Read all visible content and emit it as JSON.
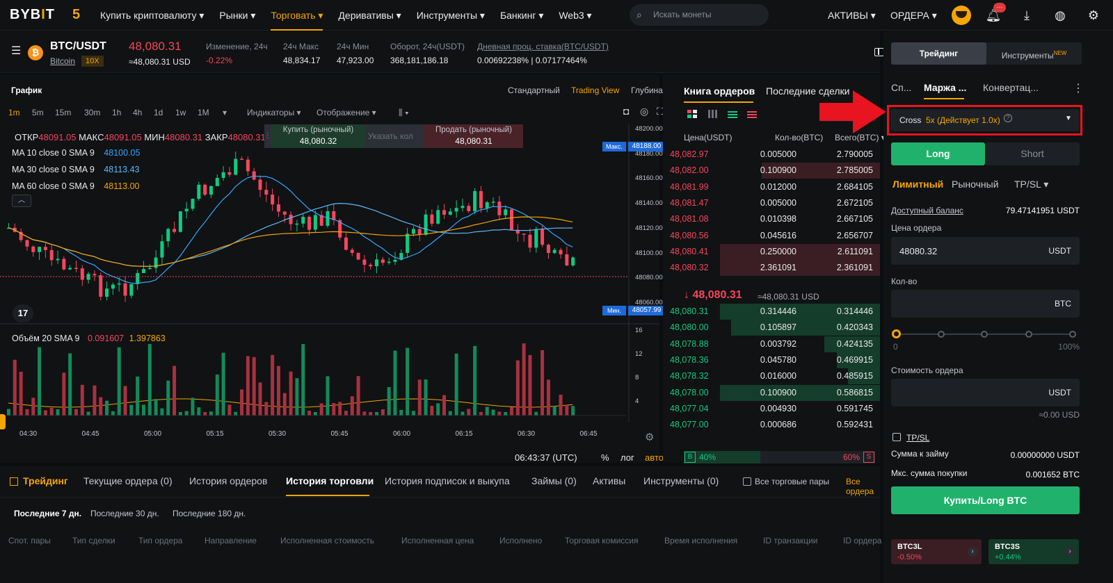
{
  "topnav": {
    "logo_a": "BYB",
    "logo_i": "I",
    "logo_b": "T",
    "logo_anniv": "5",
    "items": [
      {
        "label": "Купить криптовалюту ▾"
      },
      {
        "label": "Рынки ▾"
      },
      {
        "label": "Торговать ▾"
      },
      {
        "label": "Деривативы ▾"
      },
      {
        "label": "Инструменты ▾"
      },
      {
        "label": "Банкинг ▾"
      },
      {
        "label": "Web3 ▾"
      }
    ],
    "search_placeholder": "Искать монеты",
    "assets": "АКТИВЫ ▾",
    "orders": "ОРДЕРА ▾",
    "notif_badge": "···"
  },
  "ticker": {
    "pair": "BTC/USDT",
    "coin": "Bitcoin",
    "leverage": "10X",
    "price": "48,080.31",
    "price_usd": "≈48,080.31 USD",
    "change_label": "Изменение, 24ч",
    "change_value": "-0.22%",
    "high_label": "24ч Макс",
    "high_value": "48,834.17",
    "low_label": "24ч Мин",
    "low_value": "47,923.00",
    "turnover_label": "Оборот, 24ч(USDT)",
    "turnover_value": "368,181,186.18",
    "rate_label": "Дневная проц. ставка(BTC/USDT)",
    "rate_value": "0.00692238% | 0.07177464%"
  },
  "chart": {
    "title": "График",
    "views": [
      "Стандартный",
      "Trading View",
      "Глубина"
    ],
    "timeframes": [
      "1m",
      "5m",
      "15m",
      "30m",
      "1h",
      "4h",
      "1d",
      "1w",
      "1M"
    ],
    "indicators": "Индикаторы ▾",
    "display": "Отображение ▾",
    "ohlc": {
      "o_lbl": "ОТКР",
      "o": "48091.05",
      "h_lbl": "МАКС",
      "h": "48091.05",
      "l_lbl": "МИН",
      "l": "48080.31",
      "c_lbl": "ЗАКР",
      "c": "48080.31"
    },
    "ma": [
      {
        "label": "MA 10 close 0 SMA 9",
        "value": "48100.05",
        "color": "#35a7ff"
      },
      {
        "label": "MA 30 close 0 SMA 9",
        "value": "48113.43",
        "color": "#e9eaec"
      },
      {
        "label": "MA 60 close 0 SMA 9",
        "value": "48113.00",
        "color": "#f7a600"
      }
    ],
    "quick": {
      "buy_label": "Купить (рыночный)",
      "buy_value": "48,080.32",
      "qty_placeholder": "Указать кол",
      "sell_label": "Продать (рыночный)",
      "sell_value": "48,080.31"
    },
    "max_label": "Макс.",
    "max_value": "48188.00",
    "min_label": "Мин.",
    "min_value": "48057.99",
    "last_value": "48080.00",
    "price_ticks": [
      "48200.00",
      "48180.00",
      "48160.00",
      "48140.00",
      "48120.00",
      "48100.00",
      "48080.00",
      "48060.00"
    ],
    "volume_label": "Объём 20 SMA 9",
    "volume_v1": "0.091607",
    "volume_v2": "1.397863",
    "volume_ticks": [
      "16",
      "12",
      "8",
      "4"
    ],
    "time_ticks": [
      "04:30",
      "04:45",
      "05:00",
      "05:15",
      "05:30",
      "05:45",
      "06:00",
      "06:15",
      "06:30",
      "06:45"
    ],
    "clock": "06:43:37 (UTC)",
    "pct": "%",
    "log": "лог",
    "auto": "авто",
    "tv_logo": "17"
  },
  "orderbook": {
    "tab_book": "Книга ордеров",
    "tab_trades": "Последние сделки",
    "col_price": "Цена(USDT)",
    "col_qty": "Кол-во(BTC)",
    "col_total": "Всего(BTC) ▾",
    "asks": [
      {
        "p": "48,082.97",
        "q": "0.005000",
        "t": "2.790005",
        "d": 0.0
      },
      {
        "p": "48,082.00",
        "q": "0.100900",
        "t": "2.785005",
        "d": 0.74
      },
      {
        "p": "48,081.99",
        "q": "0.012000",
        "t": "2.684105",
        "d": 0.0
      },
      {
        "p": "48,081.47",
        "q": "0.005000",
        "t": "2.672105",
        "d": 0.0
      },
      {
        "p": "48,081.08",
        "q": "0.010398",
        "t": "2.667105",
        "d": 0.0
      },
      {
        "p": "48,080.56",
        "q": "0.045616",
        "t": "2.656707",
        "d": 0.0
      },
      {
        "p": "48,080.41",
        "q": "0.250000",
        "t": "2.611091",
        "d": 1.0
      },
      {
        "p": "48,080.32",
        "q": "2.361091",
        "t": "2.361091",
        "d": 1.0
      }
    ],
    "mid_price": "48,080.31",
    "mid_usd": "≈48,080.31 USD",
    "bids": [
      {
        "p": "48,080.31",
        "q": "0.314446",
        "t": "0.314446",
        "d": 1.0
      },
      {
        "p": "48,080.00",
        "q": "0.105897",
        "t": "0.420343",
        "d": 0.93
      },
      {
        "p": "48,078.88",
        "q": "0.003792",
        "t": "0.424135",
        "d": 0.35
      },
      {
        "p": "48,078.36",
        "q": "0.045780",
        "t": "0.469915",
        "d": 0.27
      },
      {
        "p": "48,078.32",
        "q": "0.016000",
        "t": "0.485915",
        "d": 0.2
      },
      {
        "p": "48,078.00",
        "q": "0.100900",
        "t": "0.586815",
        "d": 1.0
      },
      {
        "p": "48,077.04",
        "q": "0.004930",
        "t": "0.591745",
        "d": 0.0
      },
      {
        "p": "48,077.00",
        "q": "0.000686",
        "t": "0.592431",
        "d": 0.0
      }
    ],
    "buy_pct": "40%",
    "sell_pct": "60%",
    "buy_ratio": 0.4,
    "b_letter": "B",
    "s_letter": "S"
  },
  "bottom": {
    "tabs": [
      "Трейдинг",
      "Текущие ордера (0)",
      "История ордеров",
      "История торговли",
      "История подписок и выкупа",
      "Займы (0)",
      "Активы",
      "Инструменты (0)"
    ],
    "all_pairs": "Все торговые пары",
    "all_orders": "Все ордера",
    "periods": [
      "Последние 7 дн.",
      "Последние 30 дн.",
      "Последние 180 дн."
    ],
    "columns": [
      "Спот. пары",
      "Тип сделки",
      "Тип ордера",
      "Направление",
      "Исполненная стоимость",
      "Исполненная цена",
      "Исполнено",
      "Торговая комиссия",
      "Время исполнения",
      "ID транзакции",
      "ID ордера"
    ]
  },
  "panel": {
    "tab_trading": "Трейдинг",
    "tab_tools": "Инструменты",
    "new_badge": "NEW",
    "modes": [
      "Сп...",
      "Маржа ...",
      "Конвертац..."
    ],
    "cross": "Cross",
    "cross_lev": "5x (Действует 1.0x)",
    "long": "Long",
    "short": "Short",
    "order_types": [
      "Лимитный",
      "Рыночный",
      "TP/SL ▾"
    ],
    "balance_label": "Доступный баланс",
    "balance_value": "79.47141951 USDT",
    "price_label": "Цена ордера",
    "price_value": "48080.32",
    "price_unit": "USDT",
    "qty_label": "Кол-во",
    "qty_unit": "BTC",
    "slider_min": "0",
    "slider_max": "100%",
    "slider_value": 0,
    "cost_label": "Стоимость ордера",
    "cost_unit": "USDT",
    "cost_approx": "≈0.00 USD",
    "tpsl": "TP/SL",
    "loan_label": "Сумма к займу",
    "loan_value": "0.00000000 USDT",
    "maxbuy_label": "Мкс. сумма покупки",
    "maxbuy_value": "0.001652 BTC",
    "buy_button": "Купить/Long BTC",
    "lev_tokens": [
      {
        "name": "BTC3L",
        "change": "-0.50%"
      },
      {
        "name": "BTC3S",
        "change": "+0.44%"
      }
    ]
  }
}
